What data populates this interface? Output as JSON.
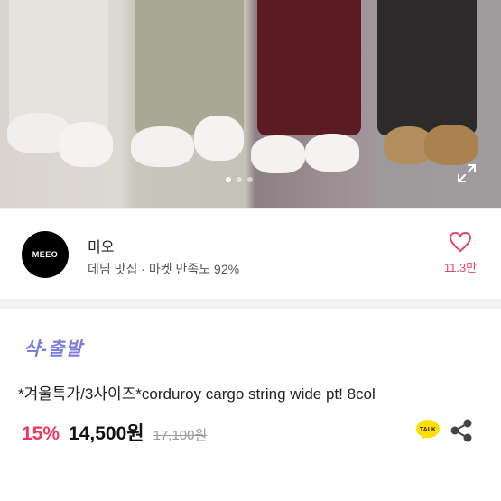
{
  "seller": {
    "avatar_text": "MEEO",
    "name": "미오",
    "description": "데님 맛집 · 마켓 만족도 92%",
    "like_count": "11.3만"
  },
  "product": {
    "brand_logo": "샥-출발",
    "title": "*겨울특가/3사이즈*corduroy cargo string wide pt! 8col",
    "discount": "15%",
    "price": "14,500원",
    "original_price": "17,100원"
  },
  "icons": {
    "talk_label": "TALK",
    "expand": "expand-icon",
    "share": "share-icon",
    "heart": "heart-icon"
  },
  "colors": {
    "accent": "#e8436a",
    "discount": "#f0365e",
    "brand": "#7b7be0",
    "kakao": "#f9e000"
  }
}
